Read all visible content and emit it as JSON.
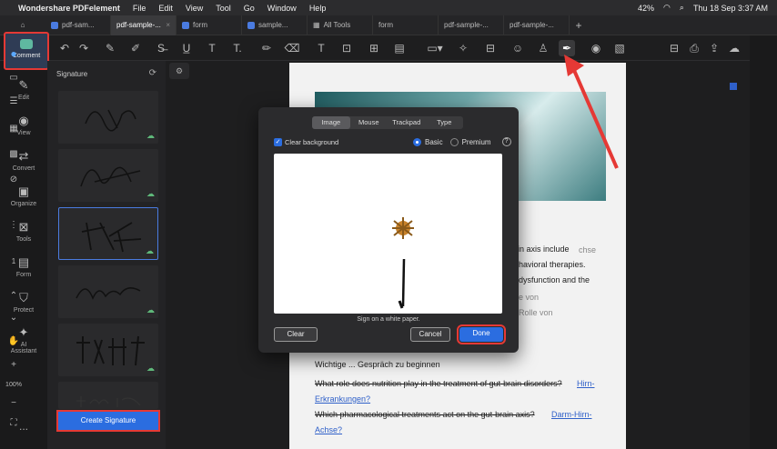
{
  "menubar": {
    "app_name": "Wondershare PDFelement",
    "items": [
      "File",
      "Edit",
      "View",
      "Tool",
      "Go",
      "Window",
      "Help"
    ],
    "battery": "42%",
    "datetime": "Thu 18 Sep  3:37 AM"
  },
  "tabs": [
    {
      "label": "pdf-sam..."
    },
    {
      "label": "pdf-sample-..."
    },
    {
      "label": "form"
    },
    {
      "label": "sample..."
    },
    {
      "label": "All Tools"
    },
    {
      "label": "form"
    },
    {
      "label": "pdf-sample-..."
    },
    {
      "label": "pdf-sample-..."
    }
  ],
  "left_rail": {
    "comment": "Comment",
    "edit": "Edit",
    "view": "View",
    "convert": "Convert",
    "organize": "Organize",
    "tools": "Tools",
    "form": "Form",
    "protect": "Protect",
    "ai_assistant": "AI\nAssistant",
    "more": "..."
  },
  "signature_panel": {
    "title": "Signature",
    "create_button": "Create Signature"
  },
  "dialog": {
    "tabs": [
      "Image",
      "Mouse",
      "Trackpad",
      "Type"
    ],
    "active_tab": "Image",
    "clear_background_label": "Clear background",
    "basic_label": "Basic",
    "premium_label": "Premium",
    "hint": "Sign on a white paper.",
    "clear_button": "Clear",
    "cancel_button": "Cancel",
    "done_button": "Done"
  },
  "document": {
    "line1": "ain axis include",
    "line1b": "chse",
    "line2": "havioral therapies.",
    "line3": "dysfunction and the",
    "line4": "e von",
    "line5": "Rolle von",
    "q_heading": "Wichtige ... Gespräch zu beginnen",
    "q1": "What role does nutrition play in the treatment of gut-brain disorders?",
    "q1_link": "Hirn-",
    "q1_link2": "Erkrankungen?",
    "q2": "Which pharmacological treatments act on the gut-brain axis?",
    "q2_link": "Darm-Hirn-",
    "q2_link2": "Achse?"
  },
  "right_rail": {
    "page_number": "1",
    "zoom": "100%"
  },
  "colors": {
    "accent": "#2b6de0",
    "highlight_red": "#e53935"
  }
}
